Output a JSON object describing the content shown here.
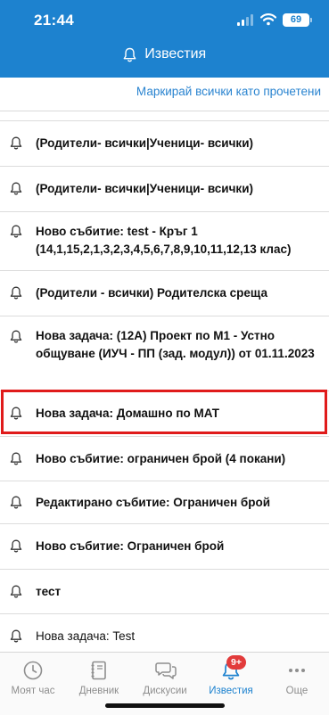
{
  "status_bar": {
    "time": "21:44",
    "battery": "69"
  },
  "header": {
    "title": "Известия",
    "icon": "bell-icon"
  },
  "actions": {
    "mark_all": "Маркирай всички като прочетени"
  },
  "notifications": [
    {
      "text": "(Родители- всички|Ученици- всички)",
      "bold": true,
      "icon": "bell-icon"
    },
    {
      "text": "(Родители- всички|Ученици- всички)",
      "bold": true,
      "icon": "bell-icon"
    },
    {
      "text": "Ново събитие: test - Кръг 1 (14,1,15,2,1,3,2,3,4,5,6,7,8,9,10,11,12,13 клас)",
      "bold": true,
      "icon": "bell-icon"
    },
    {
      "text": "(Родители - всички) Родителска среща",
      "bold": true,
      "icon": "bell-icon"
    },
    {
      "text": "Нова задача: (12А) Проект по М1 - Устно общуване (ИУЧ - ПП (зад. модул)) от 01.11.2023",
      "bold": true,
      "icon": "bell-icon"
    },
    {
      "text": "Нова задача: Домашно по МАТ",
      "bold": true,
      "icon": "bell-icon",
      "highlighted": true
    },
    {
      "text": "Ново събитие: ограничен брой (4 покани)",
      "bold": true,
      "icon": "bell-icon"
    },
    {
      "text": "Редактирано събитие: Ограничен брой",
      "bold": true,
      "icon": "bell-icon"
    },
    {
      "text": "Ново събитие: Ограничен брой",
      "bold": true,
      "icon": "bell-icon"
    },
    {
      "text": "тест",
      "bold": true,
      "icon": "bell-icon"
    },
    {
      "text": "Нова задача: Test",
      "bold": false,
      "icon": "bell-icon"
    }
  ],
  "tabbar": {
    "tabs": [
      {
        "label": "Моят час",
        "icon": "clock-icon",
        "active": false
      },
      {
        "label": "Дневник",
        "icon": "notebook-icon",
        "active": false
      },
      {
        "label": "Дискусии",
        "icon": "chat-bubbles-icon",
        "active": false
      },
      {
        "label": "Известия",
        "icon": "bell-icon",
        "active": true
      },
      {
        "label": "Още",
        "icon": "more-dots-icon",
        "active": false
      }
    ],
    "badge": "9+"
  },
  "colors": {
    "brand": "#1d82cf",
    "highlight": "#e01b1b",
    "badge": "#e23b3b",
    "inactive": "#8e8e8e"
  }
}
